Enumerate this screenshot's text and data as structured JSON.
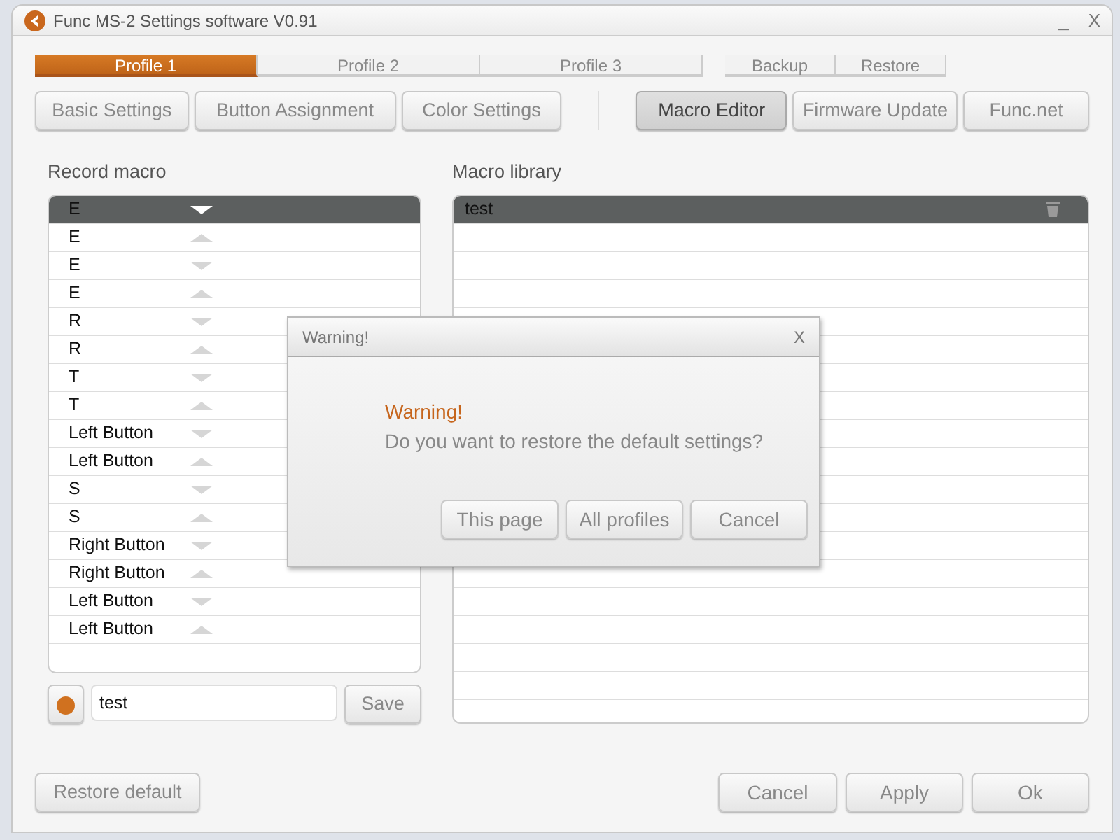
{
  "window": {
    "title": "Func MS-2 Settings software V0.91",
    "controls": [
      "_",
      "X"
    ]
  },
  "profile_tabs": [
    {
      "label": "Profile 1",
      "selected": true
    },
    {
      "label": "Profile 2",
      "selected": false
    },
    {
      "label": "Profile 3",
      "selected": false
    }
  ],
  "profile_actions": [
    "Backup",
    "Restore"
  ],
  "nav": [
    [
      {
        "label": "Basic Settings",
        "selected": false
      },
      {
        "label": "Button Assignment",
        "selected": false
      },
      {
        "label": "Color Settings",
        "selected": false
      }
    ],
    [
      {
        "label": "Macro Editor",
        "selected": true
      },
      {
        "label": "Firmware Update",
        "selected": false
      },
      {
        "label": "Func.net",
        "selected": false
      }
    ]
  ],
  "record_macro": {
    "title": "Record macro",
    "events": [
      {
        "label": "E",
        "kind": "down",
        "selected": true
      },
      {
        "label": "E",
        "kind": "up",
        "selected": false
      },
      {
        "label": "E",
        "kind": "down",
        "selected": false
      },
      {
        "label": "E",
        "kind": "up",
        "selected": false
      },
      {
        "label": "R",
        "kind": "down",
        "selected": false
      },
      {
        "label": "R",
        "kind": "up",
        "selected": false
      },
      {
        "label": "T",
        "kind": "down",
        "selected": false
      },
      {
        "label": "T",
        "kind": "up",
        "selected": false
      },
      {
        "label": "Left Button",
        "kind": "down",
        "selected": false
      },
      {
        "label": "Left Button",
        "kind": "up",
        "selected": false
      },
      {
        "label": "S",
        "kind": "down",
        "selected": false
      },
      {
        "label": "S",
        "kind": "up",
        "selected": false
      },
      {
        "label": "Right Button",
        "kind": "down",
        "selected": false
      },
      {
        "label": "Right Button",
        "kind": "up",
        "selected": false
      },
      {
        "label": "Left Button",
        "kind": "down",
        "selected": false
      },
      {
        "label": "Left Button",
        "kind": "up",
        "selected": false
      }
    ],
    "name_value": "test",
    "save": "Save"
  },
  "macro_library": {
    "title": "Macro library",
    "items": [
      {
        "label": "test",
        "selected": true
      }
    ]
  },
  "footer": {
    "restore": "Restore default",
    "buttons": [
      "Cancel",
      "Apply",
      "Ok"
    ]
  },
  "dialog": {
    "title": "Warning!",
    "close": "X",
    "heading": "Warning!",
    "message": "Do you want to restore the default settings?",
    "buttons": [
      "This page",
      "All profiles",
      "Cancel"
    ]
  }
}
